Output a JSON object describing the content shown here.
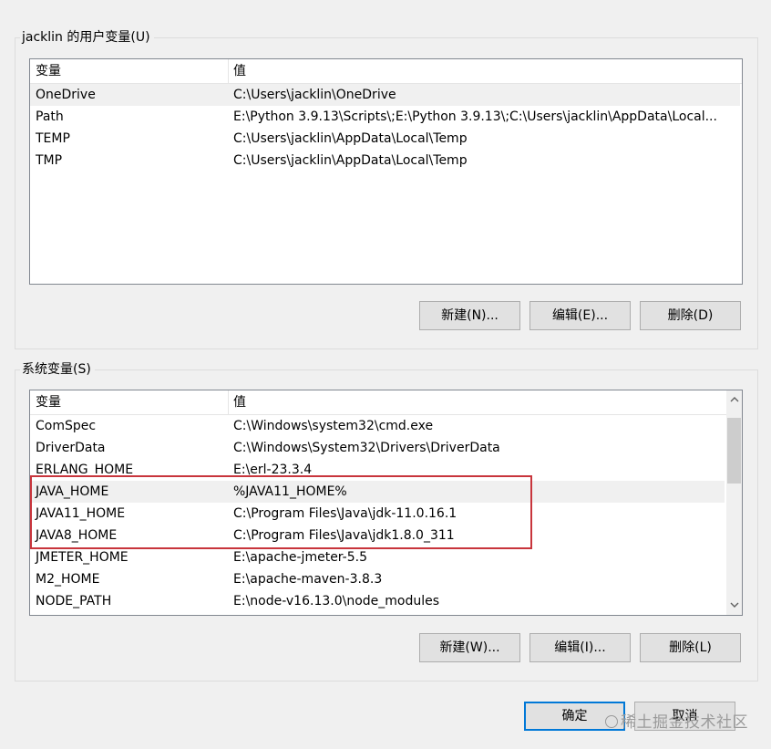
{
  "user_vars": {
    "title": "jacklin 的用户变量(U)",
    "columns": {
      "name": "变量",
      "value": "值"
    },
    "rows": [
      {
        "name": "OneDrive",
        "value": "C:\\Users\\jacklin\\OneDrive",
        "selected": true
      },
      {
        "name": "Path",
        "value": "E:\\Python 3.9.13\\Scripts\\;E:\\Python 3.9.13\\;C:\\Users\\jacklin\\AppData\\Local..."
      },
      {
        "name": "TEMP",
        "value": "C:\\Users\\jacklin\\AppData\\Local\\Temp"
      },
      {
        "name": "TMP",
        "value": "C:\\Users\\jacklin\\AppData\\Local\\Temp"
      }
    ],
    "buttons": {
      "new": "新建(N)...",
      "edit": "编辑(E)...",
      "delete": "删除(D)"
    }
  },
  "system_vars": {
    "title": "系统变量(S)",
    "columns": {
      "name": "变量",
      "value": "值"
    },
    "rows": [
      {
        "name": "ComSpec",
        "value": "C:\\Windows\\system32\\cmd.exe"
      },
      {
        "name": "DriverData",
        "value": "C:\\Windows\\System32\\Drivers\\DriverData"
      },
      {
        "name": "ERLANG_HOME",
        "value": "E:\\erl-23.3.4"
      },
      {
        "name": "JAVA_HOME",
        "value": "%JAVA11_HOME%",
        "selected": true
      },
      {
        "name": "JAVA11_HOME",
        "value": "C:\\Program Files\\Java\\jdk-11.0.16.1"
      },
      {
        "name": "JAVA8_HOME",
        "value": "C:\\Program Files\\Java\\jdk1.8.0_311"
      },
      {
        "name": "JMETER_HOME",
        "value": "E:\\apache-jmeter-5.5"
      },
      {
        "name": "M2_HOME",
        "value": "E:\\apache-maven-3.8.3"
      },
      {
        "name": "NODE_PATH",
        "value": "E:\\node-v16.13.0\\node_modules"
      }
    ],
    "buttons": {
      "new": "新建(W)...",
      "edit": "编辑(I)...",
      "delete": "删除(L)"
    }
  },
  "dialog_buttons": {
    "ok": "确定",
    "cancel": "取消"
  },
  "colors": {
    "highlight": "#c8353c",
    "focus": "#0078d7"
  },
  "icons": {
    "scroll_up": "chevron-up-icon",
    "scroll_down": "chevron-down-icon",
    "watermark": "juejin-logo-icon"
  },
  "watermark": {
    "text": "稀土掘金技术社区"
  }
}
